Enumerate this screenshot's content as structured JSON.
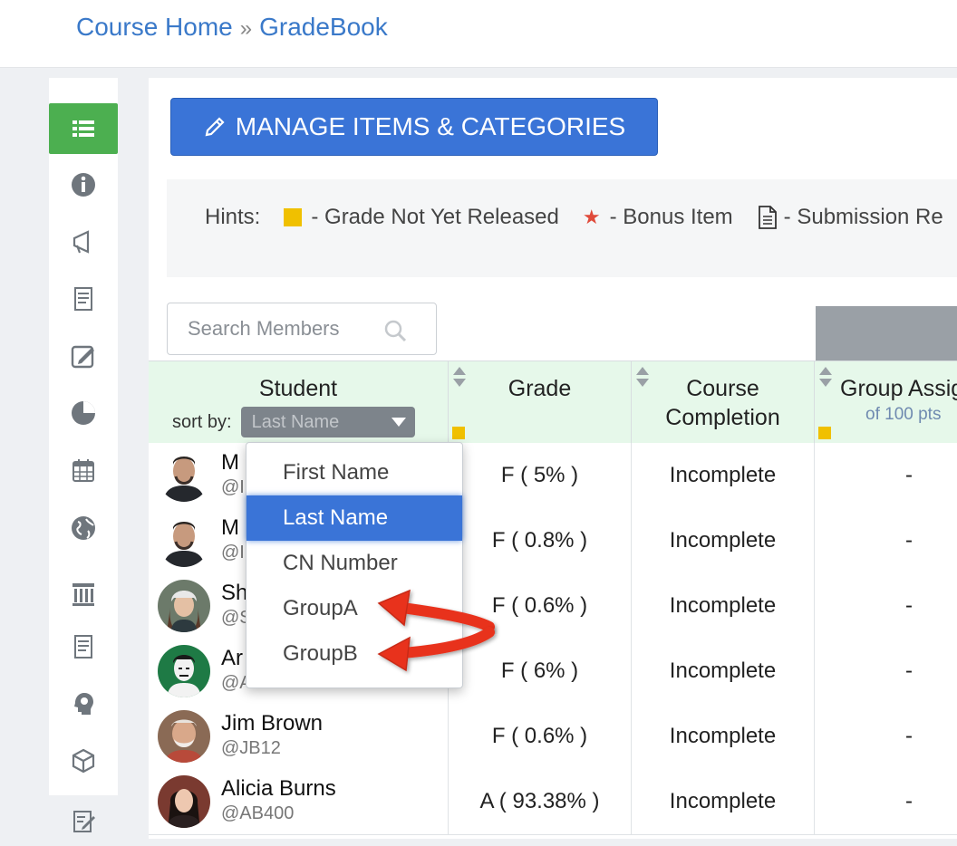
{
  "breadcrumb": {
    "home": "Course Home",
    "separator": "»",
    "current": "GradeBook"
  },
  "sidebar": {
    "items": [
      {
        "icon": "list-icon",
        "active": true
      },
      {
        "icon": "info-icon"
      },
      {
        "icon": "megaphone-icon"
      },
      {
        "icon": "document-icon"
      },
      {
        "icon": "edit-note-icon"
      },
      {
        "icon": "pie-chart-icon"
      },
      {
        "icon": "calendar-icon"
      },
      {
        "icon": "globe-icon"
      },
      {
        "icon": "building-icon"
      },
      {
        "icon": "notes-icon"
      },
      {
        "icon": "head-idea-icon"
      },
      {
        "icon": "cube-icon"
      },
      {
        "icon": "pencil-notepad-icon"
      }
    ]
  },
  "toolbar": {
    "manage_label": "MANAGE ITEMS & CATEGORIES"
  },
  "hints": {
    "label": "Hints:",
    "not_released": "- Grade Not Yet Released",
    "bonus": "- Bonus Item",
    "submission": "- Submission Re"
  },
  "search": {
    "placeholder": "Search Members"
  },
  "table": {
    "columns": {
      "student": "Student",
      "sort_by": "sort by:",
      "sort_selected": "Last Name",
      "grade": "Grade",
      "completion_line1": "Course",
      "completion_line2": "Completion",
      "group": "Group Assig",
      "group_pts": "of 100 pts"
    },
    "rows": [
      {
        "name": "M",
        "handle": "@I",
        "grade": "F ( 5% )",
        "completion": "Incomplete",
        "group": "-"
      },
      {
        "name": "M",
        "handle": "@I",
        "grade": "F ( 0.8% )",
        "completion": "Incomplete",
        "group": "-"
      },
      {
        "name": "Sh",
        "handle": "@S",
        "grade": "F ( 0.6% )",
        "completion": "Incomplete",
        "group": "-"
      },
      {
        "name": "Ar",
        "handle": "@A",
        "grade": "F ( 6% )",
        "completion": "Incomplete",
        "group": "-"
      },
      {
        "name": "Jim Brown",
        "handle": "@JB12",
        "grade": "F ( 0.6% )",
        "completion": "Incomplete",
        "group": "-"
      },
      {
        "name": "Alicia Burns",
        "handle": "@AB400",
        "grade": "A ( 93.38% )",
        "completion": "Incomplete",
        "group": "-"
      }
    ]
  },
  "sort_dropdown": {
    "options": [
      "First Name",
      "Last Name",
      "CN Number",
      "GroupA",
      "GroupB"
    ],
    "selected": "Last Name"
  },
  "colors": {
    "accent": "#3a74d7",
    "active_sidebar": "#4caf50",
    "header_bg": "#e6f8ea",
    "annotation_arrow": "#e8321e"
  }
}
